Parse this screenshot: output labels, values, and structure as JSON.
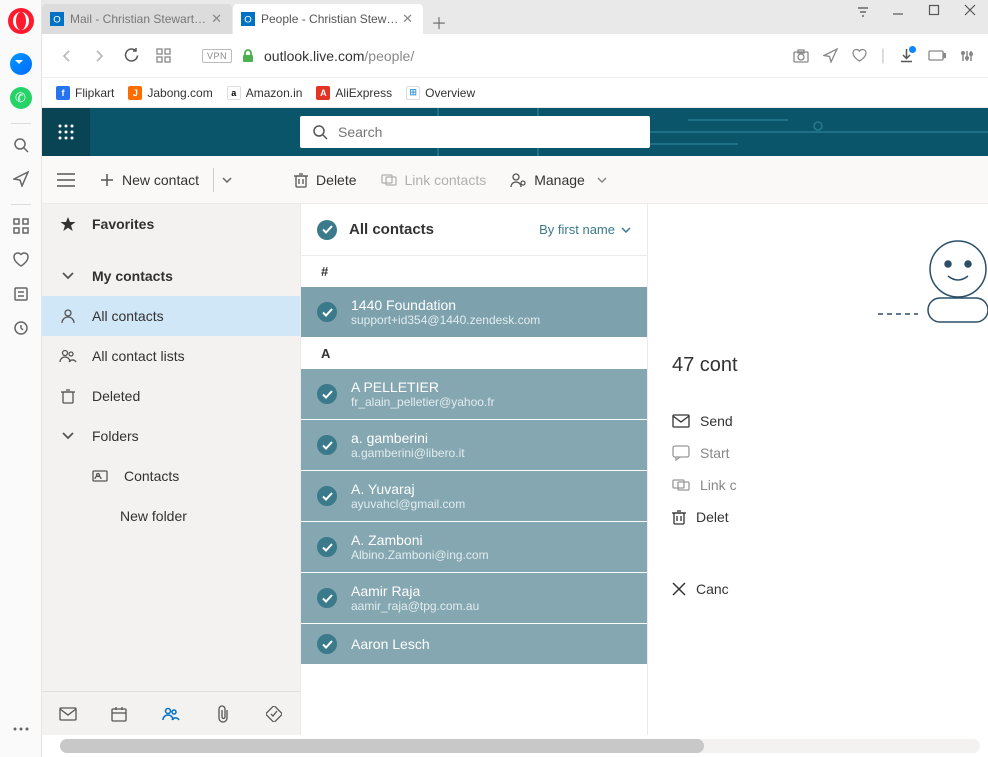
{
  "tabs": [
    {
      "title": "Mail - Christian Stewart - O",
      "active": false
    },
    {
      "title": "People - Christian Stewart -",
      "active": true
    }
  ],
  "url": {
    "host": "outlook.live.com",
    "path": "/people/"
  },
  "vpn_label": "VPN",
  "bookmarks": [
    {
      "label": "Flipkart",
      "color": "#ffd814",
      "glyph": "f"
    },
    {
      "label": "Jabong.com",
      "color": "#ff6c00",
      "glyph": "J"
    },
    {
      "label": "Amazon.in",
      "color": "#000",
      "glyph": "a"
    },
    {
      "label": "AliExpress",
      "color": "#e43225",
      "glyph": "A"
    },
    {
      "label": "Overview",
      "color": "#4aa3df",
      "glyph": "⊞"
    }
  ],
  "search": {
    "placeholder": "Search"
  },
  "toolbar": {
    "new_contact": "New contact",
    "delete": "Delete",
    "link": "Link contacts",
    "manage": "Manage"
  },
  "nav": {
    "favorites": "Favorites",
    "mycontacts": "My contacts",
    "all_contacts": "All contacts",
    "all_lists": "All contact lists",
    "deleted": "Deleted",
    "folders": "Folders",
    "contacts": "Contacts",
    "new_folder": "New folder"
  },
  "list": {
    "header": "All contacts",
    "sort": "By first name",
    "groups": [
      {
        "letter": "#",
        "items": [
          {
            "name": "1440 Foundation",
            "email": "support+id354@1440.zendesk.com"
          }
        ]
      },
      {
        "letter": "A",
        "items": [
          {
            "name": "A PELLETIER",
            "email": "fr_alain_pelletier@yahoo.fr"
          },
          {
            "name": "a. gamberini",
            "email": "a.gamberini@libero.it"
          },
          {
            "name": "A. Yuvaraj",
            "email": "ayuvahcl@gmail.com"
          },
          {
            "name": "A. Zamboni",
            "email": "Albino.Zamboni@ing.com"
          },
          {
            "name": "Aamir Raja",
            "email": "aamir_raja@tpg.com.au"
          },
          {
            "name": "Aaron Lesch",
            "email": ""
          }
        ]
      }
    ]
  },
  "detail": {
    "count_label": "47 cont",
    "send": "Send",
    "start": "Start",
    "link": "Link c",
    "delete": "Delet",
    "cancel": "Canc"
  }
}
